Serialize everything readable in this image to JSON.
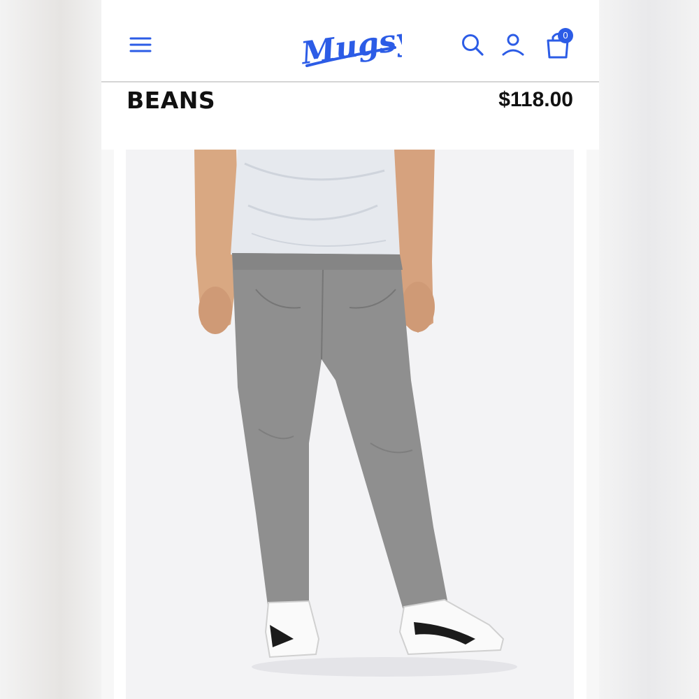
{
  "header": {
    "logo_text": "Mugsy",
    "menu_icon": "hamburger-menu-icon",
    "search_icon": "search-icon",
    "account_icon": "user-icon",
    "cart_icon": "shopping-bag-icon",
    "cart_count": "0",
    "accent_color": "#2c5ce6"
  },
  "product": {
    "name": "BEANS",
    "price": "$118.00",
    "image": "grey-jeans-model-photo"
  }
}
